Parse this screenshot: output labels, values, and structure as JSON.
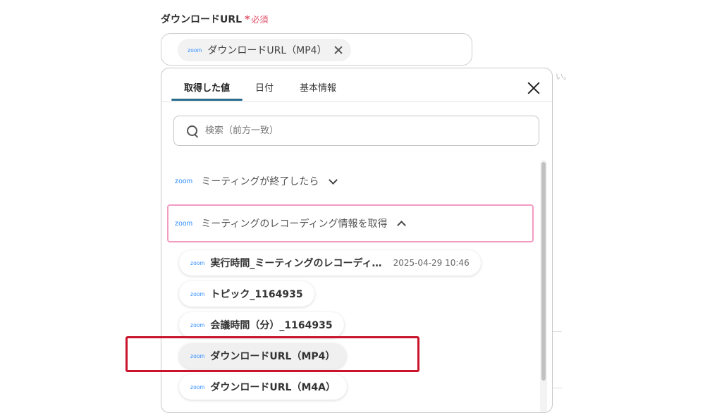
{
  "field": {
    "label": "ダウンロードURL",
    "required_star": "*",
    "required_text": "必須"
  },
  "selected_chip": {
    "logo": "zoom",
    "label": "ダウンロードURL（MP4）"
  },
  "side_fragment": "い。",
  "panel": {
    "tabs": [
      {
        "label": "取得した値"
      },
      {
        "label": "日付"
      },
      {
        "label": "基本情報"
      }
    ],
    "search": {
      "placeholder": "検索（前方一致）",
      "value": ""
    },
    "groups": [
      {
        "logo": "zoom",
        "label": "ミーティングが終了したら",
        "expanded": false
      },
      {
        "logo": "zoom",
        "label": "ミーティングのレコーディング情報を取得",
        "expanded": true
      }
    ],
    "items": [
      {
        "logo": "zoom",
        "label": "実行時間_ミーティングのレコーディ…",
        "value": "2025-04-29 10:46"
      },
      {
        "logo": "zoom",
        "label": "トピック_1164935"
      },
      {
        "logo": "zoom",
        "label": "会議時間（分）_1164935"
      },
      {
        "logo": "zoom",
        "label": "ダウンロードURL（MP4）",
        "highlighted": true
      },
      {
        "logo": "zoom",
        "label": "ダウンロードURL（M4A）"
      }
    ]
  },
  "colors": {
    "accent": "#2a6c8f",
    "required": "#e0506a",
    "zoom": "#2d8cff",
    "group_border": "#f29bc2",
    "annotation": "#c9142c"
  }
}
